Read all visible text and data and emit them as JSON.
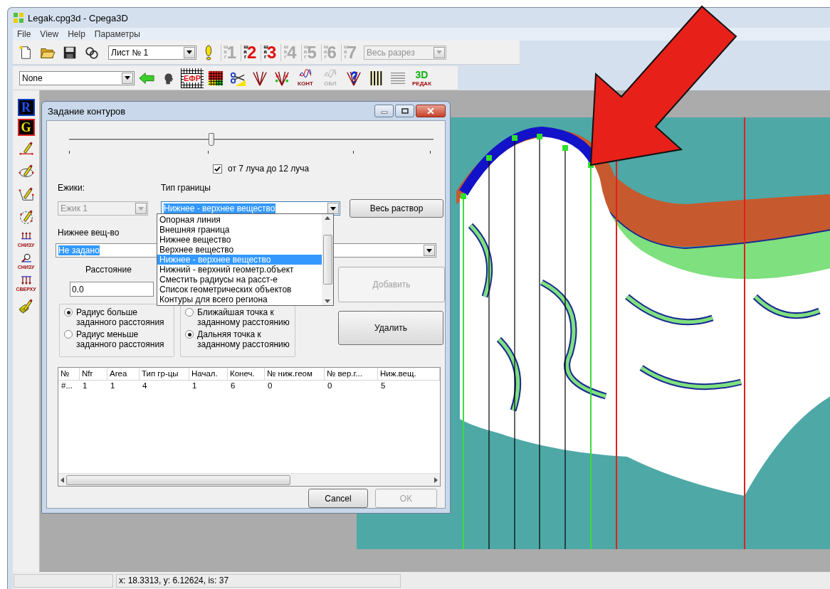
{
  "window": {
    "title": "Legak.cpg3d - Cpega3D"
  },
  "menu": [
    "File",
    "View",
    "Help",
    "Параметры"
  ],
  "toolbar_top": {
    "sheet_select": "Лист № 1",
    "view_select": "Весь разрез",
    "steps": [
      {
        "letters": "шаг",
        "number": "1",
        "active": false
      },
      {
        "letters": "шаг",
        "number": "2",
        "active": true
      },
      {
        "letters": "шаг",
        "number": "3",
        "active": true
      },
      {
        "letters": "шаг",
        "number": "4",
        "active": false
      },
      {
        "letters": "шаг",
        "number": "5",
        "active": false
      },
      {
        "letters": "шаг",
        "number": "6",
        "active": false
      },
      {
        "letters": "шаг",
        "number": "7",
        "active": false
      }
    ]
  },
  "toolbar_bottom": {
    "select": "None",
    "tools": [
      {
        "kind": "back-arrow"
      },
      {
        "kind": "profile"
      },
      {
        "kind": "grid-label",
        "label": "ЕФР"
      },
      {
        "kind": "color-grid"
      },
      {
        "kind": "scissors"
      },
      {
        "kind": "fan"
      },
      {
        "kind": "fan-dots"
      },
      {
        "kind": "wave-label",
        "label": "КОНТ",
        "disabled": false
      },
      {
        "kind": "wave-label",
        "label": "ОБЛ",
        "disabled": true
      },
      {
        "kind": "fan-question"
      },
      {
        "kind": "vertical-lines"
      },
      {
        "kind": "horizontal-lines"
      },
      {
        "kind": "stack-label",
        "top": "3D",
        "bottom": "РЕДАК"
      }
    ]
  },
  "left_toolbar": [
    {
      "kind": "r-badge",
      "label": "R"
    },
    {
      "kind": "g-badge",
      "label": "G"
    },
    {
      "kind": "pen-line"
    },
    {
      "kind": "pen-ellipse"
    },
    {
      "kind": "pen-angle"
    },
    {
      "kind": "pen-circle"
    },
    {
      "kind": "arrows-up",
      "caption": "СНИЗУ"
    },
    {
      "kind": "lens",
      "caption": "СНИЗУ"
    },
    {
      "kind": "arrows-down",
      "caption": "СВЕРХУ"
    },
    {
      "kind": "eraser-pen"
    }
  ],
  "dialog": {
    "title": "Задание контуров",
    "slider": {
      "level": 0.39
    },
    "range_checkbox": {
      "label": "от 7 луча до 12 луча",
      "checked": true
    },
    "hedgehogs_label": "Ежики:",
    "hedgehog_select": {
      "value": "Ежик 1",
      "disabled": true
    },
    "boundary_label": "Тип границы",
    "boundary_select": {
      "value": "Нижнее - верхнее вещество",
      "expanded": true,
      "options": [
        {
          "label": "Опорная линия",
          "selected": false
        },
        {
          "label": "Внешняя граница",
          "selected": false
        },
        {
          "label": "Нижнее вещество",
          "selected": false
        },
        {
          "label": "Верхнее вещество",
          "selected": false
        },
        {
          "label": "Нижнее - верхнее вещество",
          "selected": true
        },
        {
          "label": "Нижний - верхний геометр.объект",
          "selected": false
        },
        {
          "label": "Сместить радиусы на расст-е",
          "selected": false
        },
        {
          "label": "Список геометрических объектов",
          "selected": false
        },
        {
          "label": "Контуры для всего региона",
          "selected": false
        }
      ]
    },
    "whole_solution_button": "Весь раствор",
    "lower_label": "Нижнее вещ-во",
    "lower_select": "Не задано",
    "distance_label": "Расстояние",
    "distance_value": "0.0",
    "radius_options": [
      {
        "label": "Радиус больше заданного расстояния",
        "selected": true
      },
      {
        "label": "Радиус меньше заданного расстояния",
        "selected": false
      }
    ],
    "point_options": [
      {
        "label": "Ближайшая точка к заданному расстоянию",
        "selected": false
      },
      {
        "label": "Дальняя точка к заданному расстоянию",
        "selected": true
      }
    ],
    "add_button": {
      "label": "Добавить",
      "disabled": true
    },
    "delete_button": {
      "label": "Удалить",
      "disabled": false
    },
    "table": {
      "columns": [
        "№",
        "Nfr",
        "Area",
        "Тип гр-цы",
        "Начал.",
        "Конеч.",
        "№ ниж.геом",
        "№ вер.г...",
        "Ниж.вещ."
      ],
      "rows": [
        [
          "#...",
          "1",
          "1",
          "4",
          "1",
          "6",
          "0",
          "0",
          "5"
        ]
      ]
    },
    "cancel_button": {
      "label": "Cancel",
      "disabled": false
    },
    "ok_button": {
      "label": "OK",
      "disabled": true
    }
  },
  "status_bar": {
    "coordinates": "x: 18.3313, y: 6.12624, is: 37"
  }
}
